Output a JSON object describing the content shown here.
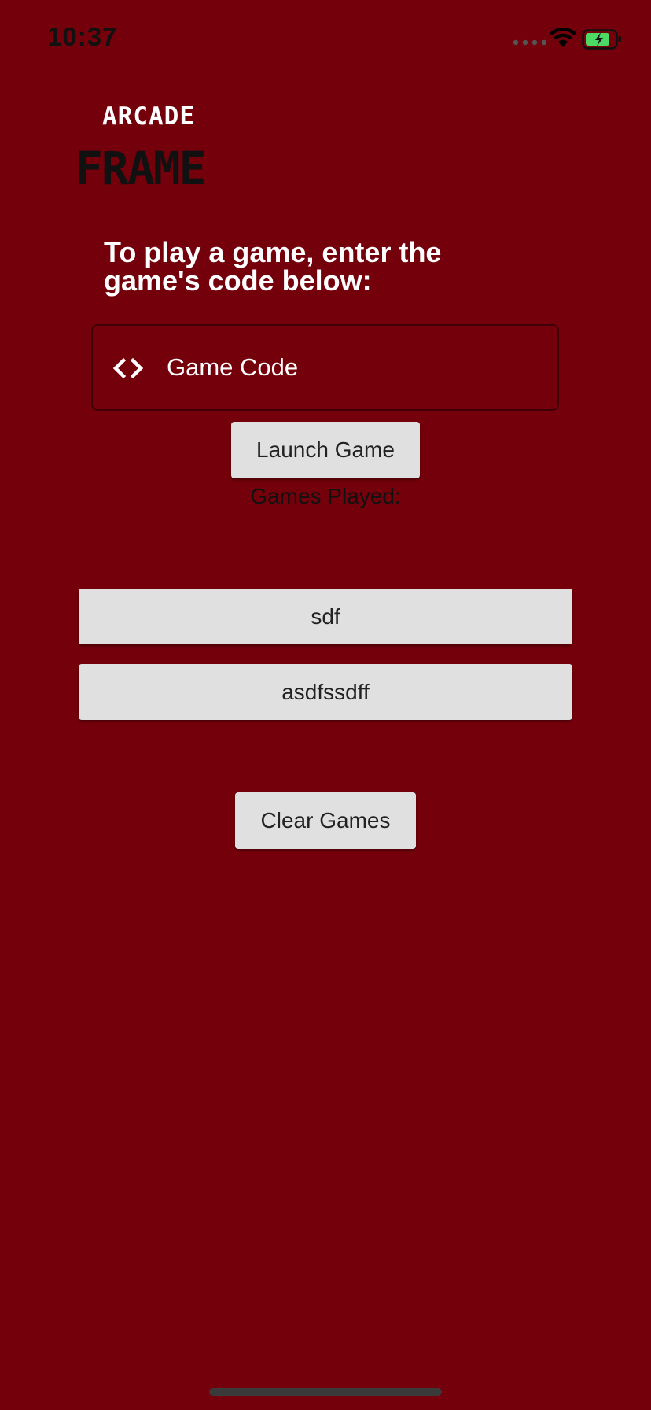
{
  "status_bar": {
    "time": "10:37",
    "battery_color": "#4cd964"
  },
  "logo": {
    "line1": "ARCADE",
    "line2": "FRAME"
  },
  "prompt": "To play a game, enter the game's code below:",
  "code_field": {
    "placeholder": "Game Code",
    "value": "",
    "icon": "code-brackets-icon"
  },
  "launch_button_label": "Launch Game",
  "games_played_label": "Games Played:",
  "games": [
    {
      "label": "sdf"
    },
    {
      "label": "asdfssdff"
    }
  ],
  "clear_button_label": "Clear Games",
  "colors": {
    "background": "#74000b",
    "button": "#e0e0e0"
  }
}
